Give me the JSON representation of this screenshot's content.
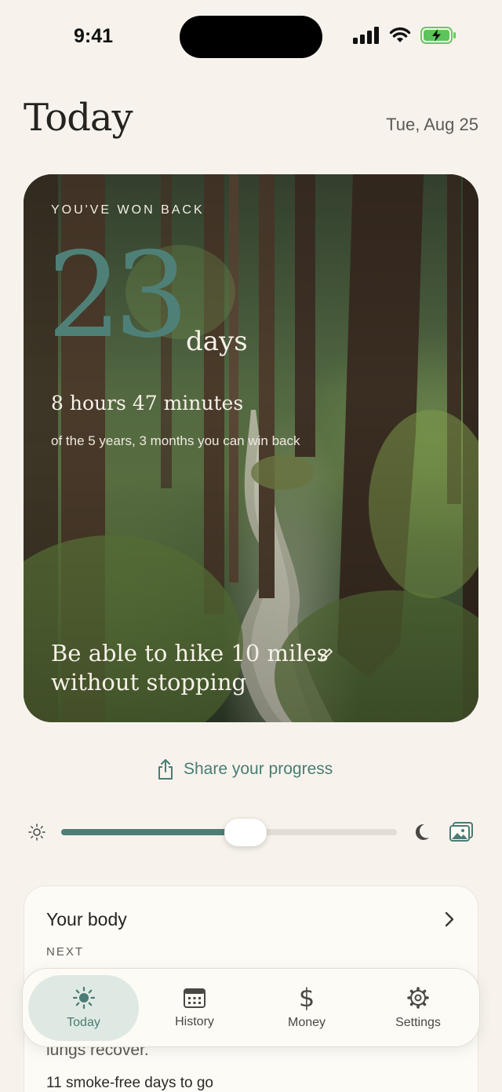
{
  "status": {
    "time": "9:41"
  },
  "header": {
    "title": "Today",
    "date": "Tue, Aug 25"
  },
  "hero": {
    "eyebrow": "YOU'VE WON BACK",
    "days_value": "23",
    "days_unit": "days",
    "sub": "8 hours 47 minutes",
    "caption": "of the 5 years, 3 months you can win back",
    "goal": "Be able to hike 10 miles without stopping"
  },
  "share": {
    "label": "Share your progress"
  },
  "slider": {
    "value": 0.548
  },
  "body_card": {
    "title": "Your body",
    "next_label": "NEXT",
    "partial_text": "lungs recover.",
    "countdown": "11 smoke-free days to go"
  },
  "tabs": [
    {
      "label": "Today",
      "icon": "sun-icon",
      "active": true
    },
    {
      "label": "History",
      "icon": "calendar-icon",
      "active": false
    },
    {
      "label": "Money",
      "icon": "dollar-icon",
      "active": false
    },
    {
      "label": "Settings",
      "icon": "gear-icon",
      "active": false
    }
  ],
  "colors": {
    "accent": "#4e7e76",
    "background": "#f7f3ec",
    "card": "#fdfbf6"
  }
}
